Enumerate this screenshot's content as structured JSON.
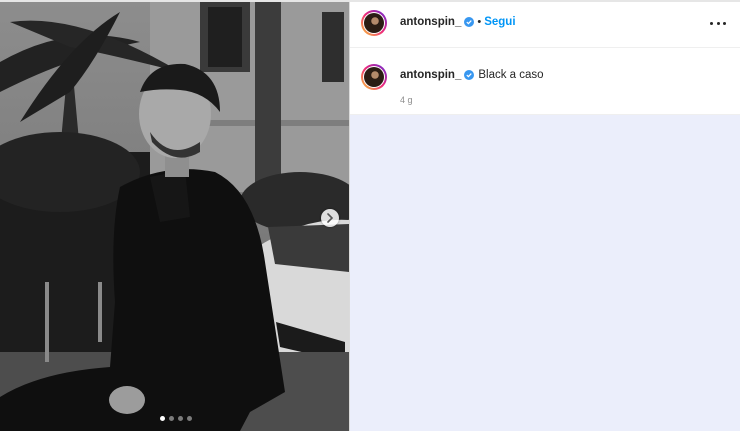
{
  "post": {
    "username": "antonspin_",
    "follow_label": "Segui",
    "separator": "•",
    "caption": "Black a caso",
    "time_ago": "4 g",
    "image_count": 4,
    "current_image": 1
  },
  "colors": {
    "accent": "#0095f6",
    "verified": "#3897f0",
    "panel_bg": "#ebeefb"
  },
  "icons": {
    "verified": "verified-badge-icon",
    "more": "more-options-icon",
    "next": "chevron-right-icon"
  }
}
